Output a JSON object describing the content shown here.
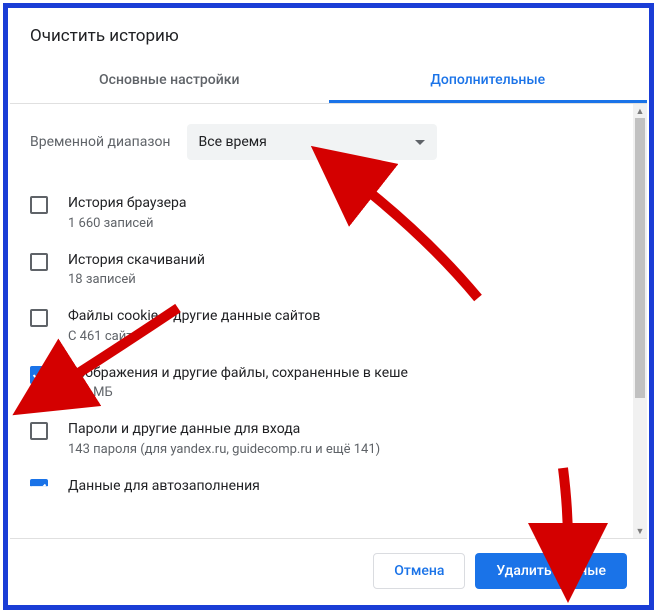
{
  "dialog": {
    "title": "Очистить историю",
    "tabs": [
      {
        "label": "Основные настройки",
        "active": false
      },
      {
        "label": "Дополнительные",
        "active": true
      }
    ],
    "timeRange": {
      "label": "Временной диапазон",
      "selected": "Все время"
    },
    "items": [
      {
        "title": "История браузера",
        "sub": "1 660 записей",
        "checked": false
      },
      {
        "title": "История скачиваний",
        "sub": "18 записей",
        "checked": false
      },
      {
        "title": "Файлы cookie и другие данные сайтов",
        "sub": "С 461 сайта",
        "checked": false
      },
      {
        "title": "Изображения и другие файлы, сохраненные в кеше",
        "sub": "319 МБ",
        "checked": true
      },
      {
        "title": "Пароли и другие данные для входа",
        "sub": "143 пароля (для yandex.ru, guidecomp.ru и ещё 141)",
        "checked": false
      },
      {
        "title": "Данные для автозаполнения",
        "sub": "",
        "checked": true
      }
    ],
    "footer": {
      "cancel": "Отмена",
      "confirm": "Удалить данные"
    }
  }
}
